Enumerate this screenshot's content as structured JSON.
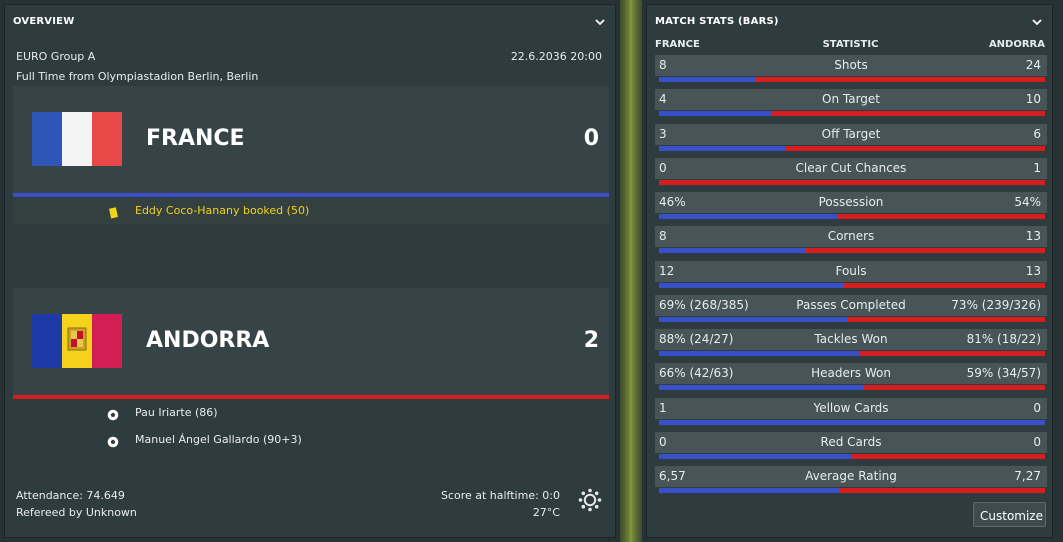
{
  "overview": {
    "title": "OVERVIEW",
    "competition": "EURO Group A",
    "datetime": "22.6.2036 20:00",
    "venue_line": "Full Time from Olympiastadion Berlin, Berlin",
    "home": {
      "name": "FRANCE",
      "score": "0",
      "line_color": "#3a50c8",
      "events": [
        {
          "icon": "yellow-card-icon",
          "text": "Eddy Coco-Hanany booked (50)"
        }
      ]
    },
    "away": {
      "name": "ANDORRA",
      "score": "2",
      "line_color": "#d61e1e",
      "events": [
        {
          "icon": "ball-icon",
          "text": "Pau Iriarte (86)"
        },
        {
          "icon": "ball-icon",
          "text": "Manuel Ángel Gallardo (90+3)"
        }
      ]
    },
    "attendance": "Attendance: 74.649",
    "referee": "Refereed by Unknown",
    "halftime": "Score at halftime: 0:0",
    "temperature": "27°C"
  },
  "stats": {
    "title": "MATCH STATS (BARS)",
    "col_home": "FRANCE",
    "col_stat": "STATISTIC",
    "col_away": "ANDORRA",
    "home_color": "#3a50c8",
    "away_color": "#d61e1e",
    "rows": [
      {
        "home": "8",
        "label": "Shots",
        "away": "24",
        "share": 0.25
      },
      {
        "home": "4",
        "label": "On Target",
        "away": "10",
        "share": 0.29
      },
      {
        "home": "3",
        "label": "Off Target",
        "away": "6",
        "share": 0.33
      },
      {
        "home": "0",
        "label": "Clear Cut Chances",
        "away": "1",
        "share": 0.0
      },
      {
        "home": "46%",
        "label": "Possession",
        "away": "54%",
        "share": 0.46
      },
      {
        "home": "8",
        "label": "Corners",
        "away": "13",
        "share": 0.38
      },
      {
        "home": "12",
        "label": "Fouls",
        "away": "13",
        "share": 0.48
      },
      {
        "home": "69% (268/385)",
        "label": "Passes Completed",
        "away": "73% (239/326)",
        "share": 0.49
      },
      {
        "home": "88% (24/27)",
        "label": "Tackles Won",
        "away": "81% (18/22)",
        "share": 0.52
      },
      {
        "home": "66% (42/63)",
        "label": "Headers Won",
        "away": "59% (34/57)",
        "share": 0.53
      },
      {
        "home": "1",
        "label": "Yellow Cards",
        "away": "0",
        "share": 1.0
      },
      {
        "home": "0",
        "label": "Red Cards",
        "away": "0",
        "share": 0.5
      },
      {
        "home": "6,57",
        "label": "Average Rating",
        "away": "7,27",
        "share": 0.47
      }
    ],
    "customize_label": "Customize"
  }
}
